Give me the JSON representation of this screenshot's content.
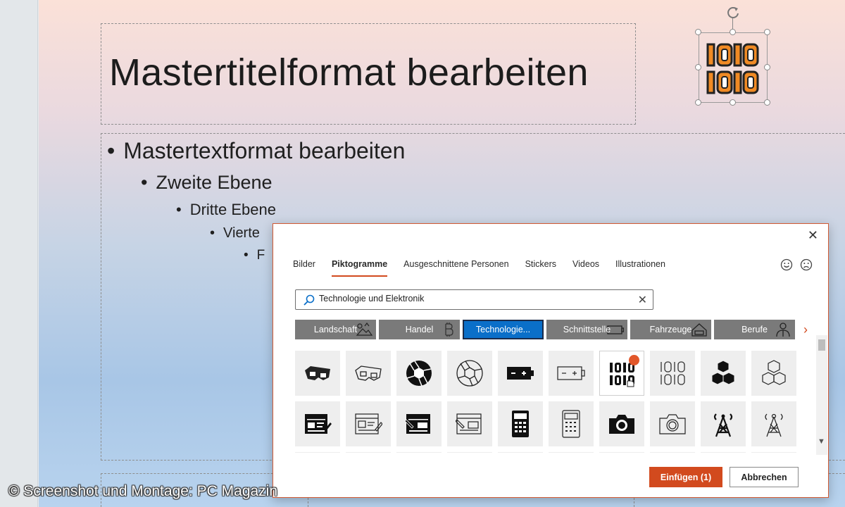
{
  "slide": {
    "title": "Mastertitelformat bearbeiten",
    "levels": [
      "Mastertextformat bearbeiten",
      "Zweite Ebene",
      "Dritte Ebene",
      "Vierte",
      "F"
    ]
  },
  "credit": "© Screenshot und Montage: PC Magazin",
  "dialog": {
    "close_label": "✕",
    "tabs": [
      {
        "label": "Bilder"
      },
      {
        "label": "Piktogramme"
      },
      {
        "label": "Ausgeschnittene Personen"
      },
      {
        "label": "Stickers"
      },
      {
        "label": "Videos"
      },
      {
        "label": "Illustrationen"
      }
    ],
    "search": {
      "value": "Technologie und Elektronik",
      "clear_label": "✕"
    },
    "chips": [
      {
        "label": "Landschaft",
        "icon": "landscape-icon"
      },
      {
        "label": "Handel",
        "icon": "bitcoin-icon"
      },
      {
        "label": "Technologie...",
        "icon": "technology-icon"
      },
      {
        "label": "Schnittstelle",
        "icon": "battery-icon"
      },
      {
        "label": "Fahrzeuge",
        "icon": "vehicle-icon"
      },
      {
        "label": "Berufe",
        "icon": "worker-icon"
      }
    ],
    "chips_next": "›",
    "icons_row1": [
      "3d-glasses-filled-icon",
      "3d-glasses-outline-icon",
      "aperture-filled-icon",
      "aperture-outline-icon",
      "battery-filled-icon",
      "battery-outline-icon",
      "binary-filled-icon",
      "binary-outline-icon",
      "blocks-filled-icon",
      "blocks-outline-icon"
    ],
    "icons_row2": [
      "browser-edit-filled-icon",
      "browser-edit-outline-icon",
      "browser-edit-filled-2-icon",
      "browser-edit-outline-2-icon",
      "calculator-filled-icon",
      "calculator-outline-icon",
      "camera-filled-icon",
      "camera-outline-icon",
      "antenna-filled-icon",
      "antenna-outline-icon"
    ],
    "insert_label": "Einfügen (1)",
    "cancel_label": "Abbrechen"
  },
  "colors": {
    "accent": "#d24a1e",
    "selected_chip": "#0a6fc9",
    "chip": "#7a7a7a",
    "selected_icon_orange": "#f08a24"
  }
}
